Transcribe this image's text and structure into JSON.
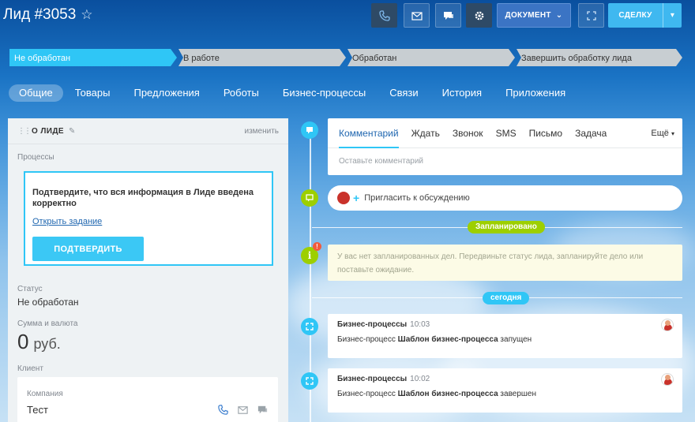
{
  "header": {
    "title": "Лид #3053",
    "star_icon": "star-icon",
    "document_label": "ДОКУМЕНТ",
    "deal_label": "СДЕЛКУ"
  },
  "stages": [
    {
      "label": "Не обработан",
      "color": "#2fc6f6",
      "active": true
    },
    {
      "label": "В работе",
      "color": "#c8ced2",
      "active": false
    },
    {
      "label": "Обработан",
      "color": "#c8ced2",
      "active": false
    },
    {
      "label": "Завершить обработку лида",
      "color": "#c8ced2",
      "active": false
    }
  ],
  "tabs": [
    "Общие",
    "Товары",
    "Предложения",
    "Роботы",
    "Бизнес-процессы",
    "Связи",
    "История",
    "Приложения"
  ],
  "lead_card": {
    "title": "О ЛИДЕ",
    "change_label": "изменить",
    "processes_label": "Процессы",
    "task_text": "Подтвердите, что вся информация в Лиде введена корректно",
    "task_link": "Открыть задание",
    "confirm_label": "ПОДТВЕРДИТЬ",
    "status_label": "Статус",
    "status_value": "Не обработан",
    "amount_label": "Сумма и валюта",
    "amount_value": "0",
    "currency": "руб.",
    "client_label": "Клиент",
    "company_label": "Компания",
    "company_value": "Тест"
  },
  "timeline": {
    "comment_tabs": [
      "Комментарий",
      "Ждать",
      "Звонок",
      "SMS",
      "Письмо",
      "Задача"
    ],
    "more_label": "Ещё",
    "comment_placeholder": "Оставьте комментарий",
    "invite_label": "Пригласить к обсуждению",
    "planned_label": "Запланировано",
    "planned_badge": "!",
    "no_plans_text": "У вас нет запланированных дел. Передвиньте статус лида, запланируйте дело или поставьте ожидание.",
    "today_label": "сегодня",
    "activities": [
      {
        "title": "Бизнес-процессы",
        "time": "10:03",
        "prefix": "Бизнес-процесс",
        "name": "Шаблон бизнес-процесса",
        "suffix": "запущен"
      },
      {
        "title": "Бизнес-процессы",
        "time": "10:02",
        "prefix": "Бизнес-процесс",
        "name": "Шаблон бизнес-процесса",
        "suffix": "завершен"
      }
    ]
  },
  "colors": {
    "accent": "#2fc6f6",
    "green": "#9dcf00",
    "link": "#2067b0"
  }
}
